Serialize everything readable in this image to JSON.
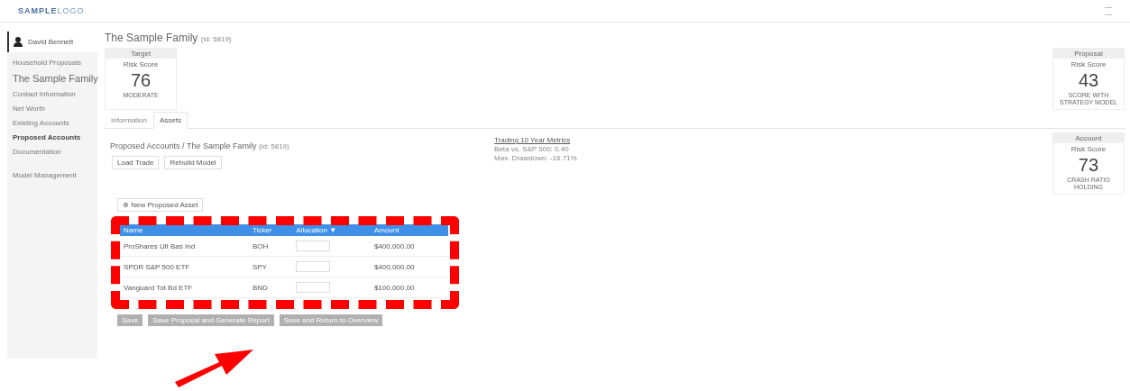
{
  "header": {
    "logo": "SAMPLE",
    "logo_suffix": "LOGO"
  },
  "sidebar": {
    "user": "David Bennett",
    "items": [
      {
        "label": "Household Proposals",
        "selected": false,
        "kind": "link"
      },
      {
        "label": "The Sample Family",
        "selected": false,
        "kind": "title"
      },
      {
        "label": "Contact Information",
        "selected": false,
        "kind": "link"
      },
      {
        "label": "Net Worth",
        "selected": false,
        "kind": "link"
      },
      {
        "label": "Existing Accounts",
        "selected": false,
        "kind": "link"
      },
      {
        "label": "Proposed Accounts",
        "selected": true,
        "kind": "link"
      },
      {
        "label": "Documentation",
        "selected": false,
        "kind": "link"
      },
      {
        "label": "Model Management",
        "selected": false,
        "kind": "gap"
      }
    ]
  },
  "title": "The Sample Family",
  "title_note": "(id: 5819)",
  "scores": [
    {
      "heading": "Target",
      "label": "Risk Score",
      "value": "76",
      "note": "MODERATE"
    },
    {
      "heading": "Proposal",
      "label": "Risk Score",
      "value": "43",
      "note": "SCORE WITH\nSTRATEGY MODEL"
    }
  ],
  "tabs": [
    {
      "label": "Information",
      "selected": false
    },
    {
      "label": "Assets",
      "selected": true
    }
  ],
  "section": {
    "title": "Proposed Accounts / The Sample Family",
    "note": "(id: 5819)",
    "buttons": [
      "Load Trade",
      "Rebuild Model"
    ],
    "metrics": {
      "title": "Trading 10 Year Metrics",
      "lines": [
        "Beta vs. S&P 500: 0.40",
        "Max. Drawdown: -16.71%"
      ]
    },
    "account": {
      "heading": "Account",
      "label": "Risk Score",
      "value": "73",
      "note": "CRASH RATIO HOLDING"
    }
  },
  "add_button": "⊕ New Proposed Asset",
  "table": {
    "columns": [
      "Name",
      "Ticker",
      "Allocation ▼",
      "Amount"
    ],
    "rows": [
      {
        "name": "ProShares Ult Bas Ind",
        "ticker": "BOH",
        "amount": "$400,000.00"
      },
      {
        "name": "SPDR S&P 500 ETF",
        "ticker": "SPY",
        "amount": "$400,000.00"
      },
      {
        "name": "Vanguard Tot Bd ETF",
        "ticker": "BND",
        "amount": "$100,000.00"
      }
    ]
  },
  "footer_buttons": [
    "Save",
    "Save Proposal and Generate Report",
    "Save and Return to Overview"
  ]
}
